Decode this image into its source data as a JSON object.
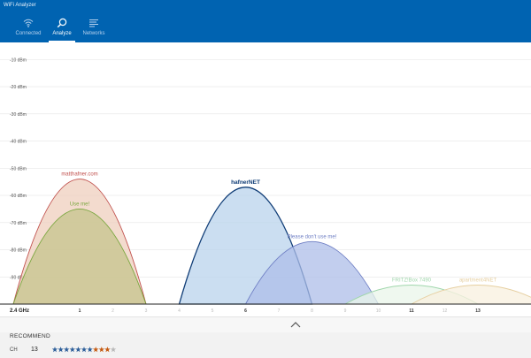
{
  "app": {
    "title": "WiFi Analyzer"
  },
  "tabs": [
    {
      "label": "Connected",
      "icon": "wifi-icon",
      "active": false
    },
    {
      "label": "Analyze",
      "icon": "search-icon",
      "active": true
    },
    {
      "label": "Networks",
      "icon": "list-icon",
      "active": false
    }
  ],
  "chart_data": {
    "type": "area",
    "band_label": "2.4 GHz",
    "ylim": [
      -100,
      -5
    ],
    "yticks": [
      -10,
      -20,
      -30,
      -40,
      -50,
      -60,
      -70,
      -80,
      -90
    ],
    "ytick_suffix": " dBm",
    "xticks": [
      1,
      2,
      3,
      4,
      5,
      6,
      7,
      8,
      9,
      10,
      11,
      12,
      13
    ],
    "bold_xticks": [
      1,
      6,
      11,
      13
    ],
    "xlim": [
      -1.4,
      14.6
    ],
    "baseline": -100,
    "grid": true,
    "series": [
      {
        "name": "matthafner.com",
        "channel": 1,
        "level": -54,
        "color": "#c0504d",
        "fill": "#efcfbe",
        "bold": false
      },
      {
        "name": "Use me!",
        "channel": 1,
        "level": -65,
        "color": "#7aa73f",
        "fill": "#c5c48c",
        "bold": false
      },
      {
        "name": "hafnerNET",
        "channel": 6,
        "level": -57,
        "color": "#0f3c76",
        "fill": "#b9d3ec",
        "bold": true
      },
      {
        "name": "Please don't use me!",
        "channel": 8,
        "level": -77,
        "color": "#6f7fc4",
        "fill": "#aebde8",
        "bold": false
      },
      {
        "name": "FRITZ!Box 7490",
        "channel": 11,
        "level": -93,
        "color": "#9fd6ab",
        "fill": "#e9f6ea",
        "bold": false
      },
      {
        "name": "apartment4NET",
        "channel": 13,
        "level": -93,
        "color": "#e6cfa0",
        "fill": "#f8f0df",
        "bold": false
      }
    ]
  },
  "recommend": {
    "title": "RECOMMEND",
    "ch_label": "CH",
    "channel": "13",
    "stars": [
      {
        "color": "#2e5f9a"
      },
      {
        "color": "#2e5f9a"
      },
      {
        "color": "#2e5f9a"
      },
      {
        "color": "#2e5f9a"
      },
      {
        "color": "#2e5f9a"
      },
      {
        "color": "#2e5f9a"
      },
      {
        "color": "#2e5f9a"
      },
      {
        "color": "#c55a11"
      },
      {
        "color": "#c55a11"
      },
      {
        "color": "#c55a11"
      },
      {
        "color": "#b8b8b8"
      }
    ]
  }
}
